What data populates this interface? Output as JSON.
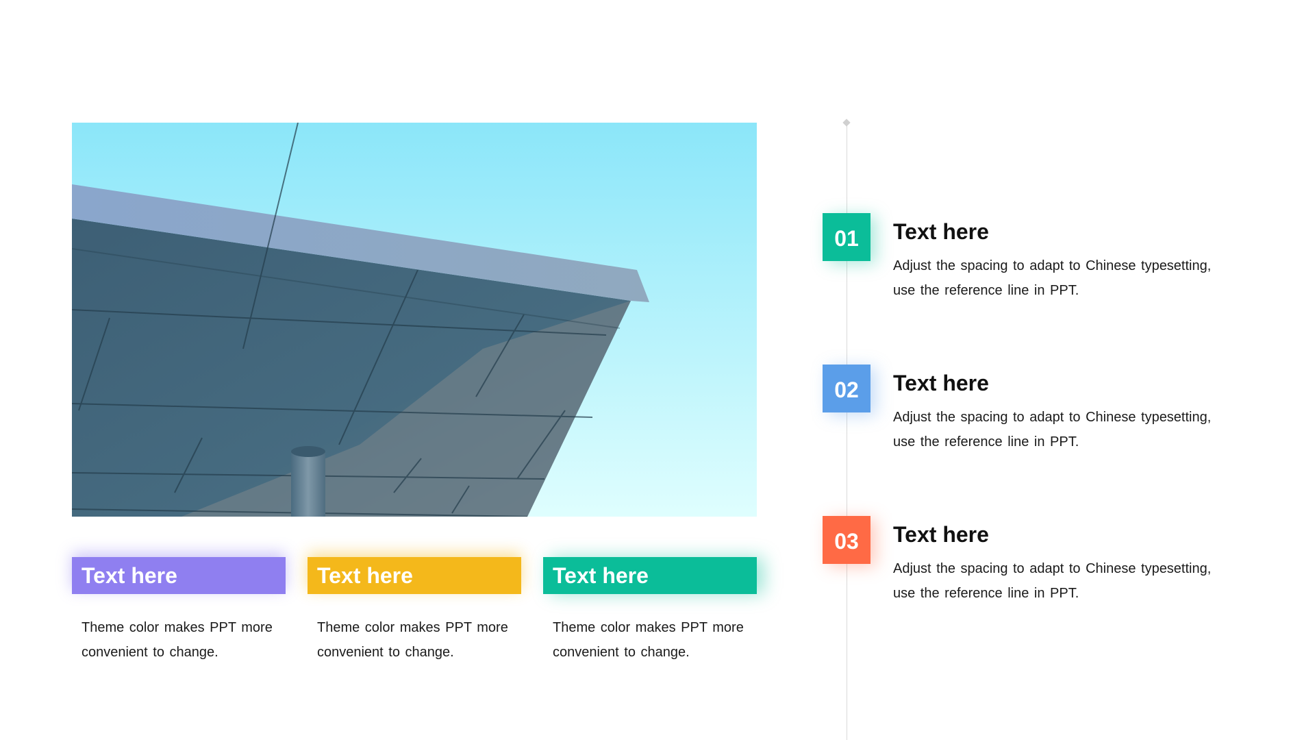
{
  "colors": {
    "purple": "#8f7ff0",
    "yellow": "#f4b81b",
    "green": "#0bbd99",
    "blue": "#5b9ee9",
    "orange": "#ff6a45",
    "sky_top": "#8be6f9",
    "sky_bottom": "#dffefe"
  },
  "image": {
    "subject": "building-canopy-against-sky"
  },
  "tags": [
    {
      "label": "Text here",
      "description": "Theme color makes PPT more convenient  to change."
    },
    {
      "label": "Text here",
      "description": "Theme color makes PPT more convenient  to change."
    },
    {
      "label": "Text here",
      "description": "Theme color makes PPT more convenient  to change."
    }
  ],
  "timeline": [
    {
      "number": "01",
      "title": "Text here",
      "description": "Adjust the spacing to adapt to Chinese typesetting, use the reference line in PPT."
    },
    {
      "number": "02",
      "title": "Text here",
      "description": "Adjust the spacing to adapt to Chinese typesetting, use the reference line in PPT."
    },
    {
      "number": "03",
      "title": "Text here",
      "description": "Adjust the spacing to adapt to Chinese typesetting, use the reference line in PPT."
    }
  ]
}
